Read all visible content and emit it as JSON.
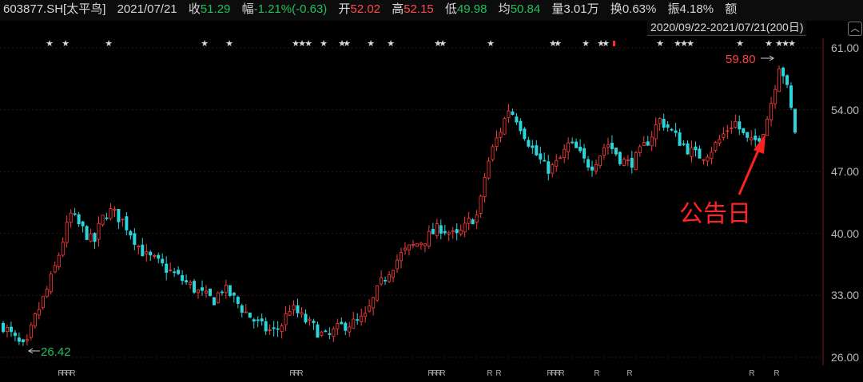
{
  "header": {
    "code": "603877.SH[太平鸟]",
    "date": "2021/07/21",
    "close_label": "收",
    "close": "51.29",
    "change_label": "幅",
    "change": "-1.21%(-0.63)",
    "open_label": "开",
    "open": "52.02",
    "high_label": "高",
    "high": "52.15",
    "low_label": "低",
    "low": "49.98",
    "avg_label": "均",
    "avg": "50.84",
    "volume_label": "量",
    "volume": "3.01万",
    "turnover_label": "换",
    "turnover": "0.63%",
    "amplitude_label": "振",
    "amplitude": "4.18%",
    "amount_label": "额"
  },
  "range": "2020/09/22-2021/07/21(200日)",
  "colors": {
    "up": "#ff3b3b",
    "down": "#2ad6dc",
    "annotation": "#ff2a2a",
    "low_label": "#21c05c"
  },
  "chart_data": {
    "type": "candlestick",
    "title": "",
    "ylim": [
      26.0,
      61.0
    ],
    "y_ticks": [
      "61.00",
      "54.00",
      "47.00",
      "40.00",
      "33.00",
      "26.00"
    ],
    "max_label": "59.80",
    "min_label": "26.42",
    "annotation": "公告日",
    "trend": [
      29.6,
      28.6,
      27.6,
      26.9,
      30.0,
      32.0,
      34.0,
      36.5,
      39.5,
      42.2,
      41.0,
      40.0,
      38.8,
      41.5,
      42.6,
      42.1,
      41.3,
      40.0,
      38.5,
      37.4,
      37.0,
      36.4,
      35.8,
      35.2,
      34.6,
      34.0,
      33.3,
      32.8,
      32.5,
      33.8,
      33.2,
      32.2,
      31.2,
      30.4,
      29.6,
      29.1,
      28.9,
      29.8,
      31.6,
      31.0,
      30.2,
      29.5,
      28.7,
      28.2,
      29.0,
      29.6,
      29.8,
      30.0,
      30.5,
      32.3,
      34.2,
      35.6,
      36.8,
      37.8,
      38.4,
      38.9,
      39.4,
      40.1,
      40.7,
      40.2,
      39.5,
      40.4,
      41.6,
      42.1,
      47.2,
      49.8,
      51.8,
      54.1,
      53.2,
      51.5,
      49.8,
      48.5,
      47.3,
      47.5,
      48.6,
      50.1,
      49.5,
      48.2,
      47.7,
      48.8,
      50.3,
      49.4,
      48.3,
      47.9,
      48.6,
      49.9,
      51.2,
      52.9,
      52.2,
      51.1,
      50.2,
      49.4,
      48.8,
      48.9,
      49.6,
      50.6,
      51.8,
      52.7,
      51.3,
      50.1,
      50.7,
      52.1,
      55.4,
      59.6,
      56.1,
      51.6
    ]
  }
}
